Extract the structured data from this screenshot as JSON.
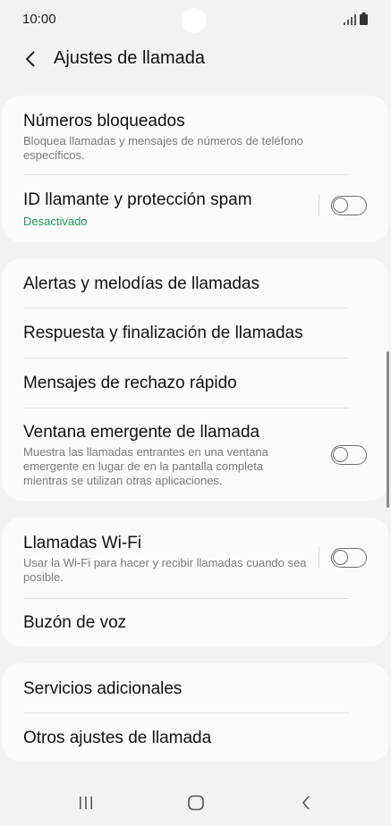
{
  "status_bar": {
    "time": "10:00"
  },
  "header": {
    "title": "Ajustes de llamada"
  },
  "cards": [
    {
      "items": [
        {
          "title": "Números bloqueados",
          "subtitle": "Bloquea llamadas y mensajes de números de teléfono específicos."
        },
        {
          "title": "ID llamante y protección spam",
          "subtitle": "Desactivado",
          "toggle_on": false
        }
      ]
    },
    {
      "items": [
        {
          "title": "Alertas y melodías de llamadas"
        },
        {
          "title": "Respuesta y finalización de llamadas"
        },
        {
          "title": "Mensajes de rechazo rápido"
        },
        {
          "title": "Ventana emergente de llamada",
          "subtitle": "Muestra las llamadas entrantes en una ventana emergente en lugar de en la pantalla completa mientras se utilizan otras aplicaciones.",
          "toggle_on": false
        }
      ]
    },
    {
      "items": [
        {
          "title": "Llamadas Wi-Fi",
          "subtitle": "Usar la Wi-Fi para hacer y recibir llamadas cuando sea posible.",
          "toggle_on": false
        },
        {
          "title": "Buzón de voz"
        }
      ]
    },
    {
      "items": [
        {
          "title": "Servicios adicionales"
        },
        {
          "title": "Otros ajustes de llamada"
        }
      ]
    }
  ],
  "colors": {
    "accent_green": "#1e9a5a",
    "background": "#f2f2f2",
    "card": "#fbfbfb"
  },
  "icons": {
    "back": "chevron-left-icon",
    "signal": "signal-icon",
    "battery": "battery-icon",
    "recents": "recents-icon",
    "home": "home-icon",
    "nav_back": "back-icon"
  }
}
